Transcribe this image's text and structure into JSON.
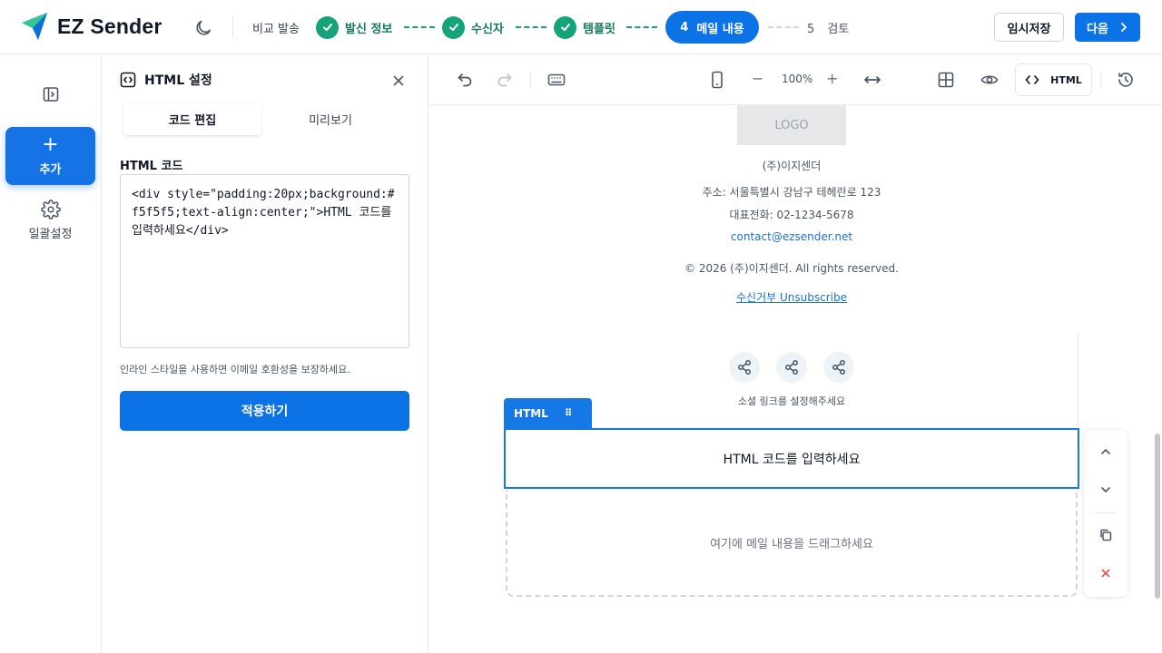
{
  "header": {
    "brand_name": "EZ Sender",
    "mode_label": "비교 발송",
    "steps": [
      {
        "label": "발신 정보",
        "status": "done"
      },
      {
        "label": "수신자",
        "status": "done"
      },
      {
        "label": "템플릿",
        "status": "done"
      },
      {
        "number": "4",
        "label": "메일 내용",
        "status": "active"
      },
      {
        "number": "5",
        "label": "검토",
        "status": "pending"
      }
    ],
    "save_label": "임시저장",
    "next_label": "다음"
  },
  "rail": {
    "add_label": "추가",
    "settings_label": "일괄설정"
  },
  "panel": {
    "title": "HTML 설정",
    "tabs": [
      {
        "label": "코드 편집",
        "active": true
      },
      {
        "label": "미리보기",
        "active": false
      }
    ],
    "code_label": "HTML 코드",
    "code_value": "<div style=\"padding:20px;background:#f5f5f5;text-align:center;\">HTML 코드를 입력하세요</div>",
    "hint": "인라인 스타일을 사용하면 이메일 호환성을 보장하세요.",
    "apply_label": "적용하기"
  },
  "toolbar": {
    "zoom": "100%",
    "html_label": "HTML"
  },
  "canvas": {
    "logo_text": "LOGO",
    "company": "(주)이지센더",
    "address": "주소: 서울특별시 강남구 테헤란로 123",
    "phone": "대표전화: 02-1234-5678",
    "email": "contact@ezsender.net",
    "copyright": "© 2026 (주)이지센더. All rights reserved.",
    "unsubscribe": "수신거부 Unsubscribe",
    "social_hint": "소셜 링크를 설정해주세요",
    "block_tag": "HTML",
    "html_block_text": "HTML 코드를 입력하세요",
    "dropzone_text": "여기에 메일 내용을 드래그하세요"
  },
  "colors": {
    "primary": "#0b73e6",
    "success": "#16a37a",
    "link": "#1e73c8"
  }
}
